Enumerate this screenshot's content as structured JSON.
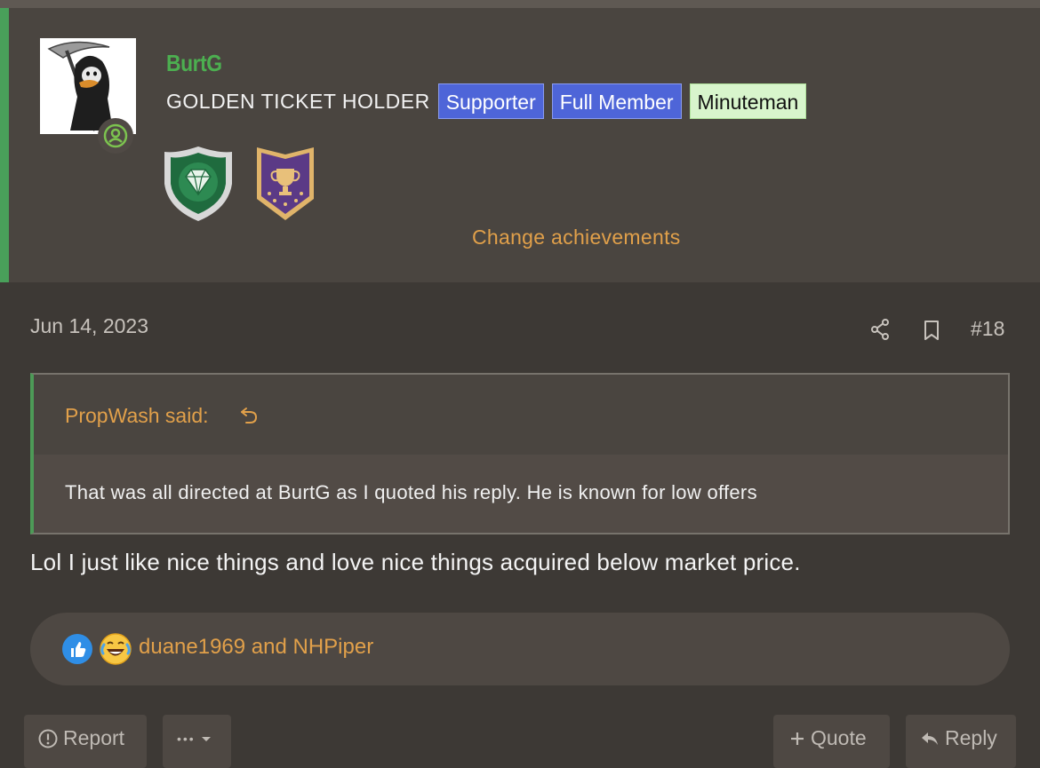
{
  "user": {
    "name": "BurtG",
    "title": "GOLDEN TICKET HOLDER",
    "banners": [
      {
        "label": "Supporter",
        "style": "blue"
      },
      {
        "label": "Full Member",
        "style": "blue"
      },
      {
        "label": "Minuteman",
        "style": "green"
      }
    ],
    "trophies": [
      "diamond-shield-icon",
      "trophy-shield-icon"
    ],
    "change_achievements": "Change achievements"
  },
  "post": {
    "date": "Jun 14, 2023",
    "number": "#18",
    "quote": {
      "author": "PropWash said:",
      "text": "That was all directed at BurtG as I quoted his reply. He is known for low offers"
    },
    "body": "Lol I just like nice things and love nice things acquired below market price.",
    "reactions": {
      "icons": [
        "like-icon",
        "laugh-icon"
      ],
      "users": "duane1969 and NHPiper"
    }
  },
  "actions": {
    "report": "Report",
    "more": "•••",
    "quote": "Quote",
    "reply": "Reply"
  },
  "colors": {
    "accent_green": "#49a05a",
    "username_green": "#4caf50",
    "link_orange": "#e1a04a",
    "banner_blue": "#4e65d8",
    "banner_green": "#d8f5cc"
  }
}
